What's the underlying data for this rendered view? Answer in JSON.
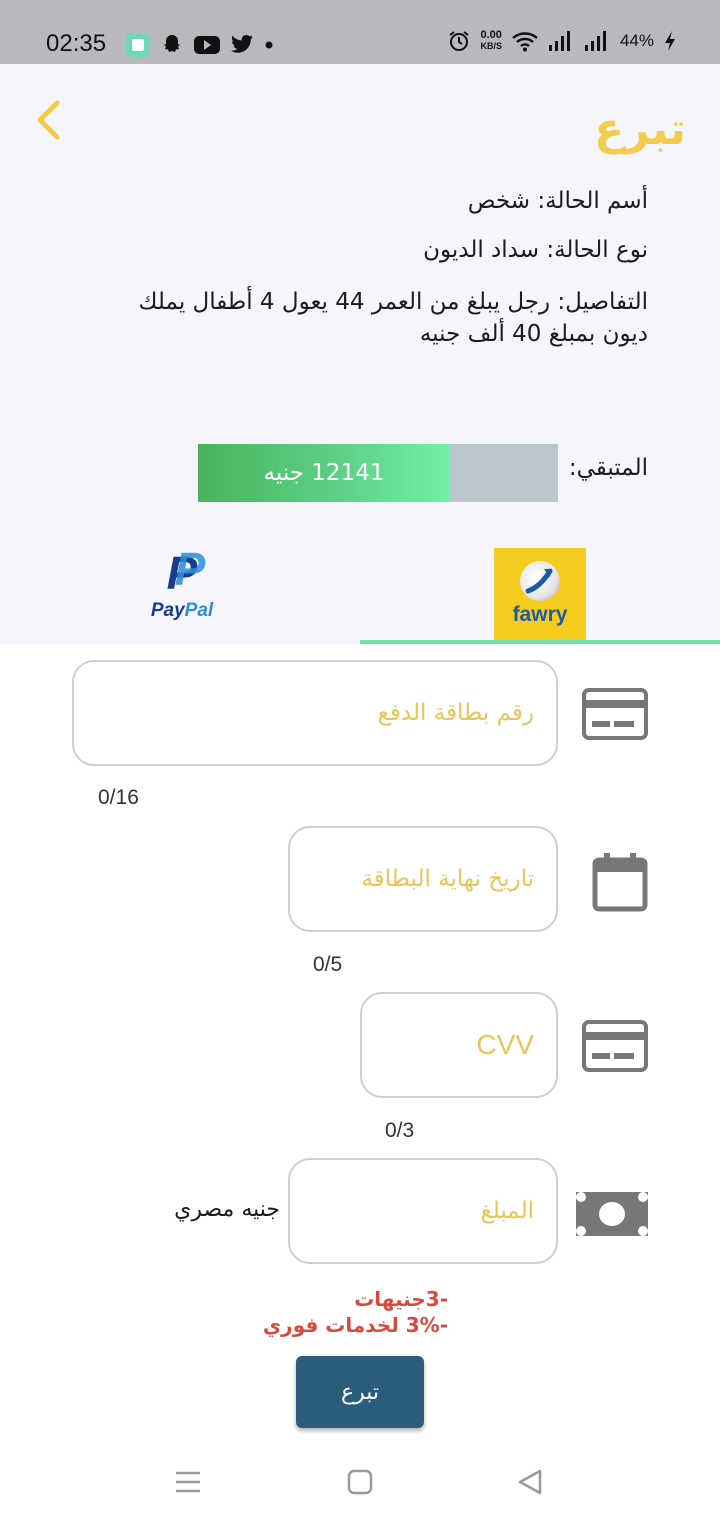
{
  "status_bar": {
    "time": "02:35",
    "net_speed_value": "0.00",
    "net_speed_unit": "KB/S",
    "battery": "44%",
    "icons": [
      "app-icon",
      "snapchat-icon",
      "youtube-icon",
      "twitter-icon",
      "dot-icon",
      "alarm-icon",
      "wifi-icon",
      "signal-icon",
      "signal-icon",
      "charging-icon"
    ]
  },
  "header": {
    "title": "تبرع",
    "back_icon": "chevron-left-icon",
    "accent_color": "#f4cb4b"
  },
  "case": {
    "name_line": "أسم الحالة: شخص",
    "type_line": "نوع الحالة: سداد الديون",
    "details_line": "التفاصيل: رجل يبلغ من العمر 44 يعول 4 أطفال يملك ديون بمبلغ 40 ألف جنيه"
  },
  "remaining": {
    "label": "المتبقي:",
    "amount_text": "12141 جنيه",
    "fill_fraction": 0.7
  },
  "payment_tabs": {
    "paypal": {
      "mark": "P",
      "pay": "Pay",
      "pal": "Pal"
    },
    "fawry": {
      "text": "fawry"
    },
    "selected": "fawry"
  },
  "form": {
    "card_number": {
      "placeholder": "رقم بطاقة الدفع",
      "value": "",
      "counter": "0/16",
      "icon": "credit-card-icon"
    },
    "expiry": {
      "placeholder": "تاريخ نهاية البطاقة",
      "value": "",
      "counter": "0/5",
      "icon": "calendar-icon"
    },
    "cvv": {
      "placeholder": "CVV",
      "value": "",
      "counter": "0/3",
      "icon": "credit-card-icon"
    },
    "amount": {
      "placeholder": "المبلغ",
      "value": "",
      "currency": "جنيه مصري",
      "icon": "cash-icon"
    },
    "fee_line_1": "-3جنيهات",
    "fee_line_2": "-3% لخدمات فوري",
    "fee_color": "#d84a3f",
    "submit_label": "تبرع",
    "button_color": "#2c5c7c"
  },
  "nav_bar": {
    "icons": [
      "menu-icon",
      "home-square-icon",
      "back-triangle-icon"
    ]
  }
}
